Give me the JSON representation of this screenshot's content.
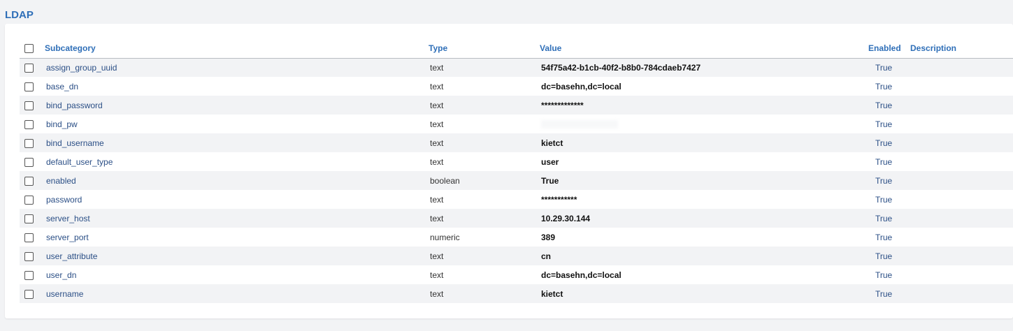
{
  "section": {
    "title": "LDAP"
  },
  "table": {
    "headers": {
      "subcategory": "Subcategory",
      "type": "Type",
      "value": "Value",
      "enabled": "Enabled",
      "description": "Description"
    },
    "rows": [
      {
        "subcategory": "assign_group_uuid",
        "type": "text",
        "value": "54f75a42-b1cb-40f2-b8b0-784cdaeb7427",
        "enabled": "True",
        "description": ""
      },
      {
        "subcategory": "base_dn",
        "type": "text",
        "value": "dc=basehn,dc=local",
        "enabled": "True",
        "description": ""
      },
      {
        "subcategory": "bind_password",
        "type": "text",
        "value": "*************",
        "enabled": "True",
        "description": ""
      },
      {
        "subcategory": "bind_pw",
        "type": "text",
        "value": "",
        "enabled": "True",
        "description": ""
      },
      {
        "subcategory": "bind_username",
        "type": "text",
        "value": "kietct",
        "enabled": "True",
        "description": ""
      },
      {
        "subcategory": "default_user_type",
        "type": "text",
        "value": "user",
        "enabled": "True",
        "description": ""
      },
      {
        "subcategory": "enabled",
        "type": "boolean",
        "value": "True",
        "enabled": "True",
        "description": ""
      },
      {
        "subcategory": "password",
        "type": "text",
        "value": "***********",
        "enabled": "True",
        "description": ""
      },
      {
        "subcategory": "server_host",
        "type": "text",
        "value": "10.29.30.144",
        "enabled": "True",
        "description": ""
      },
      {
        "subcategory": "server_port",
        "type": "numeric",
        "value": "389",
        "enabled": "True",
        "description": ""
      },
      {
        "subcategory": "user_attribute",
        "type": "text",
        "value": "cn",
        "enabled": "True",
        "description": ""
      },
      {
        "subcategory": "user_dn",
        "type": "text",
        "value": "dc=basehn,dc=local",
        "enabled": "True",
        "description": ""
      },
      {
        "subcategory": "username",
        "type": "text",
        "value": "kietct",
        "enabled": "True",
        "description": ""
      }
    ]
  }
}
